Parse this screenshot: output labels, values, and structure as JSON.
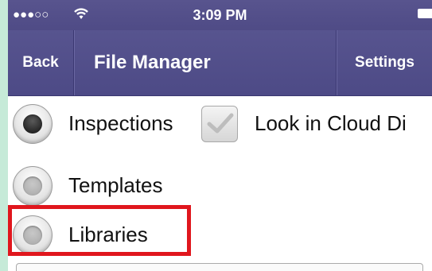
{
  "status_bar": {
    "signal": "●●●○○",
    "time": "3:09 PM",
    "wifi_icon": "wifi-icon",
    "battery_icon": "battery-icon"
  },
  "nav": {
    "back_label": "Back",
    "title": "File Manager",
    "settings_label": "Settings"
  },
  "options": [
    {
      "label": "Inspections",
      "selected": true
    },
    {
      "label": "Templates",
      "selected": false
    },
    {
      "label": "Libraries",
      "selected": false
    }
  ],
  "cloud_checkbox": {
    "label": "Look in Cloud Di",
    "checked": true
  },
  "colors": {
    "nav_bar": "#4f4b86",
    "highlight": "#e0161d"
  }
}
